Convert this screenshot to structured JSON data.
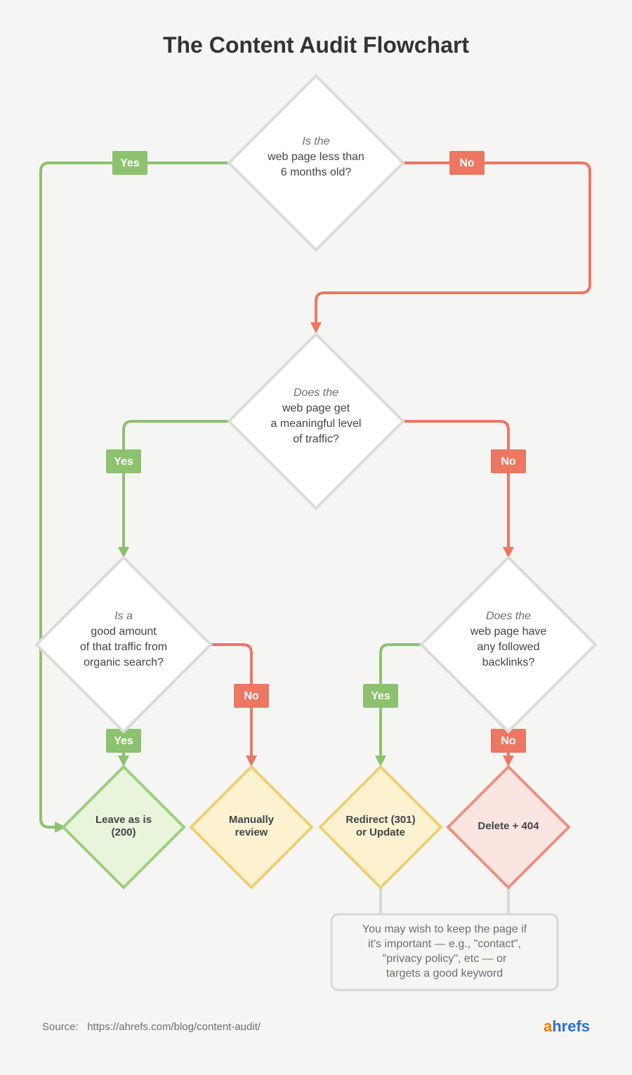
{
  "title": "The Content Audit Flowchart",
  "labels": {
    "yes": "Yes",
    "no": "No"
  },
  "q1": {
    "lead": "Is the",
    "l1": "web page less than",
    "l2": "6 months old?"
  },
  "q2": {
    "lead": "Does the",
    "l1": "web page get",
    "l2": "a meaningful level",
    "l3": "of traffic?"
  },
  "q3": {
    "lead": "Is a",
    "l1": "good amount",
    "l2": "of that traffic from",
    "l3": "organic search?"
  },
  "q4": {
    "lead": "Does the",
    "l1": "web page have",
    "l2": "any followed",
    "l3": "backlinks?"
  },
  "out": {
    "leave": {
      "l1": "Leave as is",
      "l2": "(200)"
    },
    "review": {
      "l1": "Manually",
      "l2": "review"
    },
    "redirect": {
      "l1": "Redirect (301)",
      "l2": "or Update"
    },
    "delete": {
      "l1": "Delete + 404"
    }
  },
  "note": {
    "l1": "You may wish to keep the page if",
    "l2": "it's important  — e.g., \"contact\",",
    "l3": "\"privacy policy\", etc — or",
    "l4": "targets a good keyword"
  },
  "source": {
    "label": "Source:",
    "url": "https://ahrefs.com/blog/content-audit/"
  },
  "brand": {
    "a": "a",
    "rest": "hrefs"
  }
}
